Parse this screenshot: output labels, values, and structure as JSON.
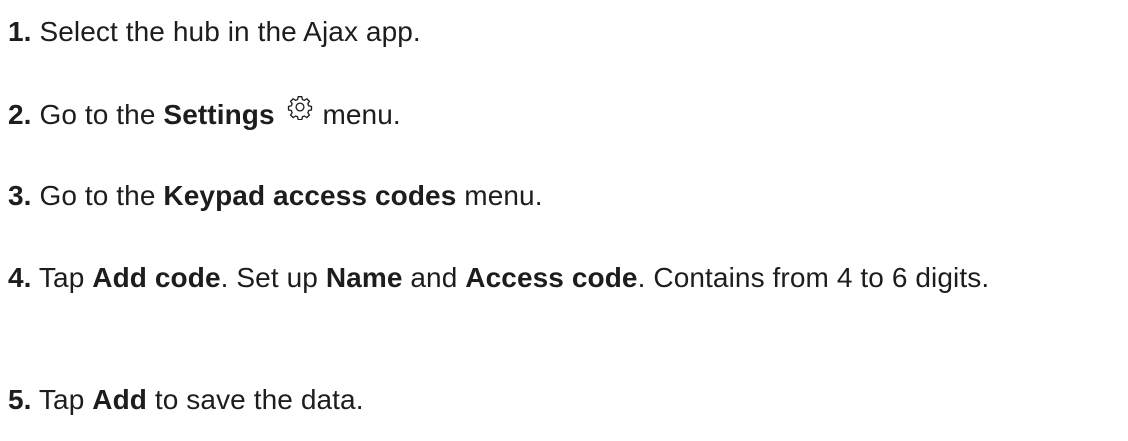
{
  "steps": [
    {
      "number": "1.",
      "text": " Select the hub in the Ajax app."
    },
    {
      "number": "2.",
      "pre": " Go to the ",
      "bold": "Settings",
      "icon": "gear-icon",
      "post": " menu."
    },
    {
      "number": "3.",
      "pre": " Go to the ",
      "bold": "Keypad access codes",
      "post": " menu."
    },
    {
      "number": "4.",
      "t1": " Tap ",
      "b1": "Add code",
      "t2": ". Set up ",
      "b2": "Name",
      "t3": " and ",
      "b3": "Access code",
      "t4": ". Contains from 4 to 6 digits."
    },
    {
      "number": "5.",
      "pre": " Tap ",
      "bold": "Add",
      "post": " to save the data."
    }
  ],
  "colors": {
    "text": "#1d1d1f",
    "background": "#ffffff"
  }
}
